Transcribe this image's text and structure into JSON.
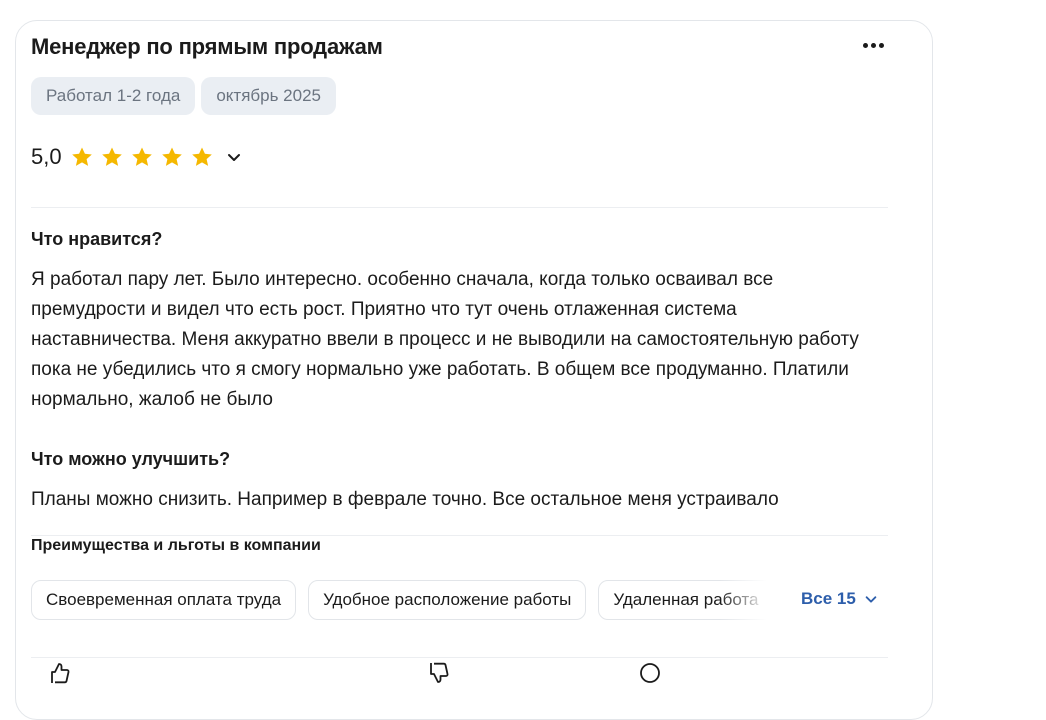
{
  "review": {
    "title": "Менеджер по прямым продажам",
    "tags": [
      "Работал 1-2 года",
      "октябрь 2025"
    ],
    "rating": "5,0",
    "stars": 5,
    "colors": {
      "star": "#f5b800",
      "accent": "#2d5eab",
      "chip_bg": "#eaeef3"
    },
    "likes": {
      "heading": "Что нравится?",
      "text": "Я работал пару лет. Было интересно. особенно сначала, когда только осваивал все премудрости и видел что есть рост. Приятно что тут очень отлаженная система наставничества. Меня аккуратно ввели в процесс и не выводили на самостоятельную работу пока не убедились что я смогу нормально уже работать. В общем все продуманно. Платили нормально, жалоб не было"
    },
    "improve": {
      "heading": "Что можно улучшить?",
      "text": "Планы можно снизить. Например в феврале точно. Все остальное меня устраивало"
    },
    "benefits": {
      "heading": "Преимущества и льготы в компании",
      "items": [
        "Своевременная оплата труда",
        "Удобное расположение работы",
        "Удаленная работа"
      ],
      "all_label": "Все 15"
    }
  }
}
